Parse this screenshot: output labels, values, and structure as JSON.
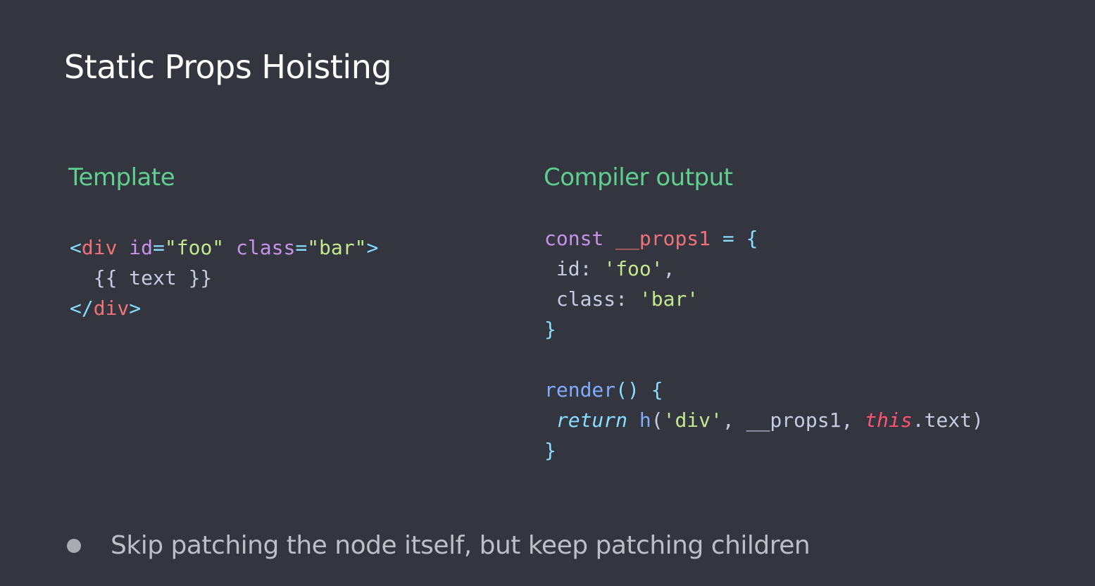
{
  "slide": {
    "title": "Static Props Hoisting",
    "bullet": "Skip patching the node itself, but keep patching children"
  },
  "left": {
    "heading": "Template",
    "code": {
      "l1_open": "<",
      "l1_tag": "div",
      "l1_sp1": " ",
      "l1_attr1": "id",
      "l1_eq1": "=",
      "l1_val1": "\"foo\"",
      "l1_sp2": " ",
      "l1_attr2": "class",
      "l1_eq2": "=",
      "l1_val2": "\"bar\"",
      "l1_close": ">",
      "l2_text": "  {{ text }}",
      "l3_open": "</",
      "l3_tag": "div",
      "l3_close": ">"
    }
  },
  "right": {
    "heading": "Compiler output",
    "code": {
      "l1_kw": "const",
      "l1_sp": " ",
      "l1_var": "__props1",
      "l1_eq": " = ",
      "l1_brace": "{",
      "l2_key": " id: ",
      "l2_val": "'foo'",
      "l2_comma": ",",
      "l3_key": " class: ",
      "l3_val": "'bar'",
      "l4_brace": "}",
      "l6_fn": "render",
      "l6_rest": "() {",
      "l7_sp": " ",
      "l7_ret": "return",
      "l7_sp2": " ",
      "l7_h": "h",
      "l7_paren": "(",
      "l7_str": "'div'",
      "l7_mid": ", __props1, ",
      "l7_this": "this",
      "l7_tail": ".text)",
      "l8_brace": "}"
    }
  }
}
